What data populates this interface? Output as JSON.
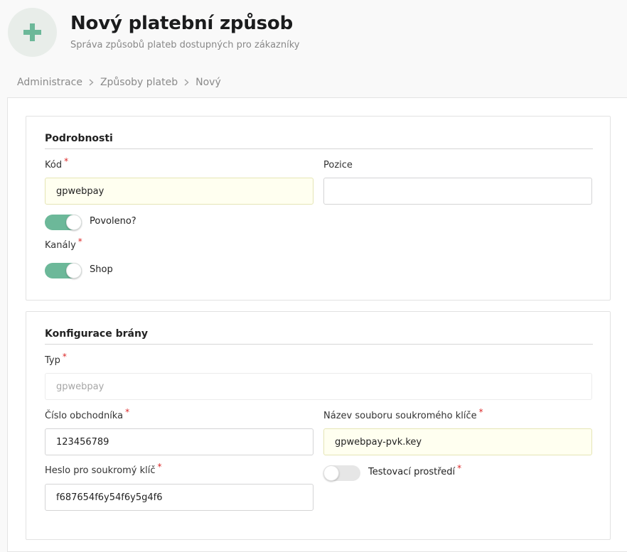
{
  "header": {
    "title": "Nový platební způsob",
    "subtitle": "Správa způsobů plateb dostupných pro zákazníky",
    "icon": "plus-icon",
    "accent_color": "#6cb899"
  },
  "breadcrumb": {
    "items": [
      "Administrace",
      "Způsoby plateb",
      "Nový"
    ]
  },
  "details": {
    "title": "Podrobnosti",
    "code": {
      "label": "Kód",
      "required": "*",
      "value": "gpwebpay"
    },
    "position": {
      "label": "Pozice",
      "value": ""
    },
    "enabled": {
      "label": "Povoleno?",
      "checked": true
    },
    "channels": {
      "label": "Kanály",
      "required": "*",
      "shop_label": "Shop",
      "shop_checked": true
    }
  },
  "gateway": {
    "title": "Konfigurace brány",
    "type": {
      "label": "Typ",
      "required": "*",
      "value": "gpwebpay"
    },
    "merchant_number": {
      "label": "Číslo obchodníka",
      "required": "*",
      "value": "123456789"
    },
    "private_key_file": {
      "label": "Název souboru soukromého klíče",
      "required": "*",
      "value": "gpwebpay-pvk.key"
    },
    "private_key_password": {
      "label": "Heslo pro soukromý klíč",
      "required": "*",
      "value": "f687654f6y54f6y5g4f6"
    },
    "test_environment": {
      "label": "Testovací prostředí",
      "required": "*",
      "checked": false
    }
  }
}
